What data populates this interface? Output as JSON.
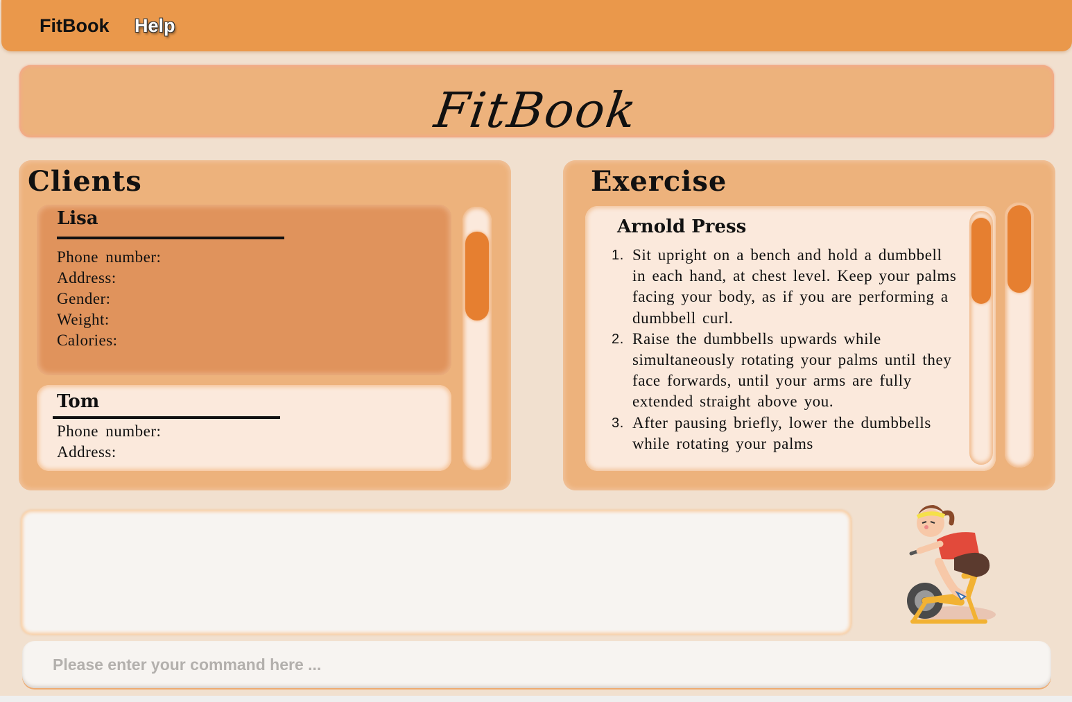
{
  "menu": {
    "app_label": "FitBook",
    "help_label": "Help"
  },
  "app_title": "FitBook",
  "clients": {
    "heading": "Clients",
    "list": [
      {
        "name": "Lisa",
        "selected": true,
        "fields": [
          "Phone number:",
          "Address:",
          "Gender:",
          "Weight:",
          "Calories:"
        ]
      },
      {
        "name": "Tom",
        "selected": false,
        "fields": [
          "Phone number:",
          "Address:"
        ]
      }
    ]
  },
  "exercise": {
    "heading": "Exercise",
    "name": "Arnold Press",
    "steps": [
      {
        "num": "1.",
        "text": "Sit upright on a bench and hold a dumbbell in each hand, at chest level. Keep your palms facing your body, as if you are performing a dumbbell curl."
      },
      {
        "num": "2.",
        "text": "Raise the dumbbells upwards while simultaneously rotating your palms until they face forwards, until your arms are fully extended straight above you."
      },
      {
        "num": "3.",
        "text": "After pausing briefly, lower the dumbbells while rotating your palms"
      }
    ]
  },
  "result_display": "",
  "command": {
    "placeholder": "Please enter your command here ..."
  },
  "colors": {
    "menubar": "#ea984b",
    "panel": "#edb27c",
    "selected_card": "#e0935c",
    "accent": "#e67f30",
    "background": "#f1e0cf"
  },
  "icons": {
    "mascot": "cyclist-icon"
  }
}
